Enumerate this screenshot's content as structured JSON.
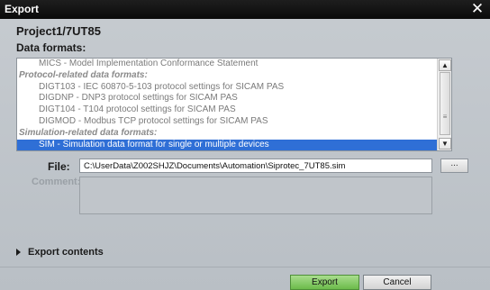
{
  "window": {
    "title": "Export",
    "close_glyph": "✕"
  },
  "project": "Project1/7UT85",
  "data_formats": {
    "label": "Data formats:",
    "rows": [
      {
        "text": "MICS - Model Implementation Conformance Statement",
        "kind": "item",
        "selected": false
      },
      {
        "text": "Protocol-related data formats:",
        "kind": "group",
        "selected": false
      },
      {
        "text": "DIGT103 - IEC 60870-5-103 protocol settings for SICAM PAS",
        "kind": "item",
        "selected": false
      },
      {
        "text": "DIGDNP - DNP3 protocol settings for SICAM PAS",
        "kind": "item",
        "selected": false
      },
      {
        "text": "DIGT104 - T104 protocol settings for SICAM PAS",
        "kind": "item",
        "selected": false
      },
      {
        "text": "DIGMOD - Modbus TCP protocol settings for SICAM PAS",
        "kind": "item",
        "selected": false
      },
      {
        "text": "Simulation-related data formats:",
        "kind": "group",
        "selected": false
      },
      {
        "text": "SIM - Simulation data format for single or multiple devices",
        "kind": "item",
        "selected": true
      }
    ],
    "scrollbar": {
      "up_icon": "chevron-up-icon",
      "down_icon": "chevron-down-icon"
    }
  },
  "file": {
    "label": "File:",
    "value": "C:\\UserData\\Z002SHJZ\\Documents\\Automation\\Siprotec_7UT85.sim",
    "browse_label": "..."
  },
  "comment": {
    "label": "Comment:",
    "value": ""
  },
  "export_contents": {
    "label": "Export contents",
    "icon": "expand-arrow-icon"
  },
  "buttons": {
    "export": "Export",
    "cancel": "Cancel"
  },
  "colors": {
    "selection": "#2f6fd6",
    "export_button": "#6cbb4b",
    "titlebar": "#0a0a0a",
    "dialog_bg": "#bcc2c8"
  }
}
